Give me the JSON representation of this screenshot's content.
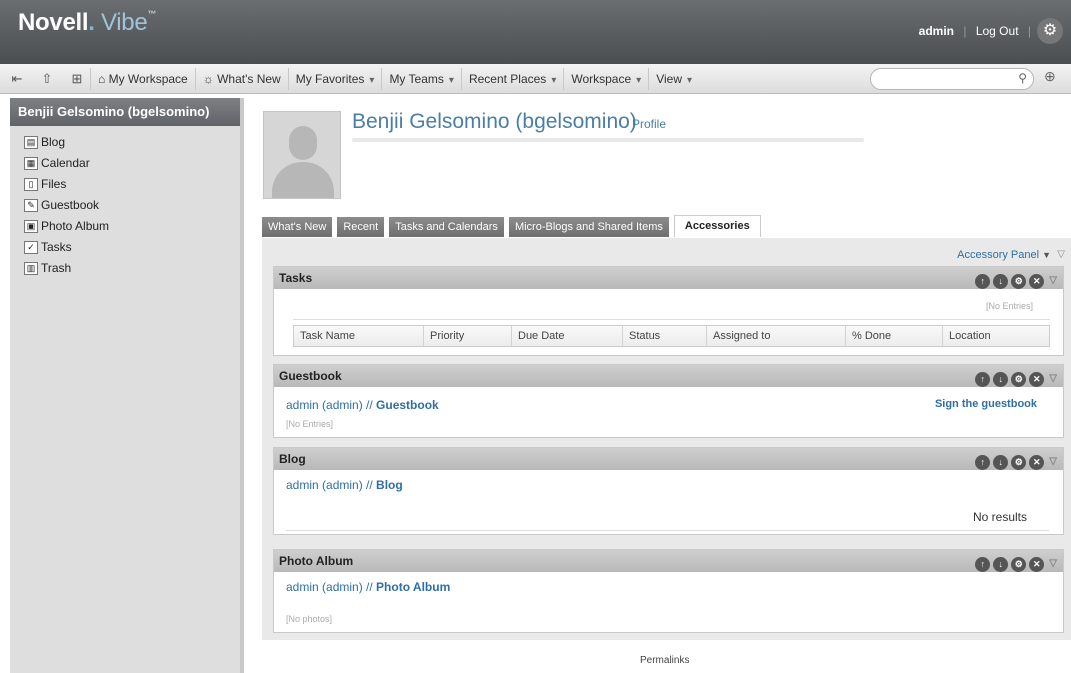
{
  "header": {
    "logo_main": "Novell",
    "logo_dot": ".",
    "logo_sub": "Vibe",
    "logo_tm": "™",
    "username": "admin",
    "separator": "|",
    "logout": "Log Out",
    "gear_icon": "gear-icon"
  },
  "toolbar": {
    "items": [
      {
        "label": "My Workspace",
        "icon": "home-icon"
      },
      {
        "label": "What's New",
        "icon": "whats-new-icon"
      },
      {
        "label": "My Favorites",
        "arrow": "▾"
      },
      {
        "label": "My Teams",
        "arrow": "▾"
      },
      {
        "label": "Recent Places",
        "arrow": "▾"
      },
      {
        "label": "Workspace",
        "arrow": "▾"
      },
      {
        "label": "View",
        "arrow": "▾"
      }
    ],
    "search_placeholder": ""
  },
  "sidebar": {
    "title": "Benjii Gelsomino (bgelsomino)",
    "items": [
      {
        "label": "Blog",
        "icon": "blog-icon"
      },
      {
        "label": "Calendar",
        "icon": "calendar-icon"
      },
      {
        "label": "Files",
        "icon": "files-icon"
      },
      {
        "label": "Guestbook",
        "icon": "guestbook-icon"
      },
      {
        "label": "Photo Album",
        "icon": "photo-album-icon"
      },
      {
        "label": "Tasks",
        "icon": "tasks-icon"
      },
      {
        "label": "Trash",
        "icon": "trash-icon"
      }
    ]
  },
  "profile": {
    "name": "Benjii Gelsomino (bgelsomino)",
    "profile_link": "Profile"
  },
  "tabs": [
    "What's New",
    "Recent",
    "Tasks and Calendars",
    "Micro-Blogs and Shared Items",
    "Accessories"
  ],
  "accessory_panel": "Accessory Panel",
  "panels": {
    "tasks": {
      "title": "Tasks",
      "no_entries": "[No Entries]",
      "columns": [
        "Task Name",
        "Priority",
        "Due Date",
        "Status",
        "Assigned to",
        "% Done",
        "Location"
      ]
    },
    "guestbook": {
      "title": "Guestbook",
      "bc_user": "admin (admin) // ",
      "bc_target": "Guestbook",
      "sign": "Sign the guestbook",
      "no_entries": "[No Entries]"
    },
    "blog": {
      "title": "Blog",
      "bc_user": "admin (admin) // ",
      "bc_target": "Blog",
      "no_results": "No results"
    },
    "photo_album": {
      "title": "Photo Album",
      "bc_user": "admin (admin) // ",
      "bc_target": "Photo Album",
      "no_photos": "[No photos]"
    }
  },
  "footer": {
    "permalinks": "Permalinks"
  }
}
